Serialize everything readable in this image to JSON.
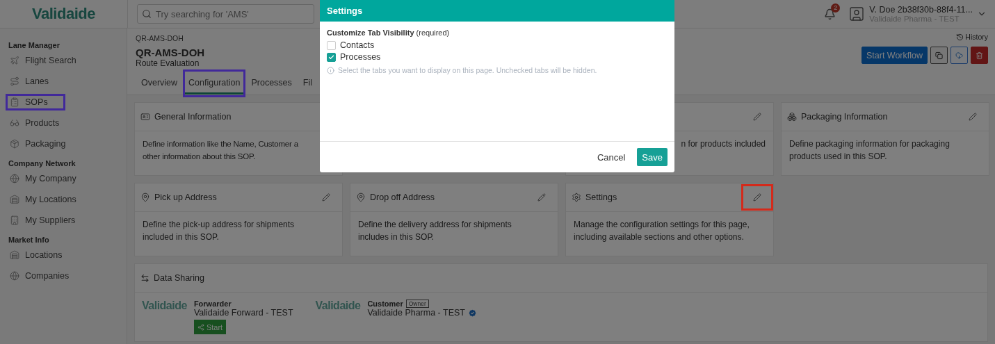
{
  "logo": {
    "text": "Validaide"
  },
  "search": {
    "placeholder": "Try searching for 'AMS'"
  },
  "notifications": {
    "count": "2"
  },
  "user": {
    "name": "V. Doe 2b38f30b-88f4-11...",
    "organization": "Validaide Pharma - TEST"
  },
  "sidebar": {
    "sections": [
      {
        "title": "Lane Manager",
        "items": [
          {
            "label": "Flight Search",
            "highlighted": false
          },
          {
            "label": "Lanes",
            "highlighted": false
          },
          {
            "label": "SOPs",
            "highlighted": true
          },
          {
            "label": "Products",
            "highlighted": false
          },
          {
            "label": "Packaging",
            "highlighted": false
          }
        ]
      },
      {
        "title": "Company Network",
        "items": [
          {
            "label": "My Company",
            "highlighted": false
          },
          {
            "label": "My Locations",
            "highlighted": false
          },
          {
            "label": "My Suppliers",
            "highlighted": false
          }
        ]
      },
      {
        "title": "Market Info",
        "items": [
          {
            "label": "Locations",
            "highlighted": false
          },
          {
            "label": "Companies",
            "highlighted": false
          }
        ]
      }
    ]
  },
  "header": {
    "breadcrumb": "QR-AMS-DOH",
    "title": "QR-AMS-DOH",
    "subtitle": "Route Evaluation",
    "history": "History",
    "tabs": [
      {
        "label": "Overview",
        "selected": false,
        "highlighted": false
      },
      {
        "label": "Configuration",
        "selected": true,
        "highlighted": true
      },
      {
        "label": "Processes",
        "selected": false,
        "highlighted": false
      },
      {
        "label": "Fil",
        "selected": false,
        "highlighted": false
      }
    ],
    "actions": [
      {
        "kind": "primary",
        "label": "Start Workflow"
      },
      {
        "kind": "copy"
      },
      {
        "kind": "download"
      },
      {
        "kind": "delete"
      }
    ]
  },
  "cards": [
    {
      "title": "General Information",
      "description_lines": [
        "Define information like the Name, Customer a",
        "other information about this SOP."
      ]
    },
    {
      "description_lines": [
        "n for products included"
      ],
      "edit": {
        "highlighted": false
      }
    },
    {
      "title": "Packaging Information",
      "description_lines": [
        "Define packaging information for packaging",
        "products used in this SOP."
      ],
      "edit": {
        "highlighted": false
      }
    },
    {
      "title": "Pick up Address",
      "description_lines": [
        "Define the pick-up address for shipments",
        "included in this SOP."
      ],
      "edit": {
        "highlighted": false
      }
    },
    {
      "title": "Drop off Address",
      "description_lines": [
        "Define the delivery address for shipments",
        "includes in this SOP."
      ],
      "edit": {
        "highlighted": false
      }
    },
    {
      "title": "Settings",
      "description_lines": [
        "Manage the configuration settings for this page,",
        "including available sections and other options."
      ],
      "edit": {
        "highlighted": true
      }
    }
  ],
  "data_sharing": {
    "title": "Data Sharing",
    "parties": [
      {
        "logo": "Validaide",
        "role": "Forwarder",
        "name": "Validaide Forward - TEST",
        "start": "Start",
        "verified": false
      },
      {
        "logo": "Validaide",
        "role": "Customer",
        "badge": "Owner",
        "name": "Validaide Pharma - TEST",
        "verified": true
      }
    ]
  },
  "dialog": {
    "title": "Settings",
    "label": "**Customize Tab Visibility** (required)",
    "options": [
      {
        "label": "Contacts",
        "checked": false
      },
      {
        "label": "Processes",
        "checked": true
      }
    ],
    "hint": "Select the tabs you want to display on this page. Unchecked tabs will be hidden.",
    "buttons": [
      {
        "kind": "cancel",
        "label": "Cancel"
      },
      {
        "kind": "save",
        "label": "Save"
      }
    ]
  }
}
